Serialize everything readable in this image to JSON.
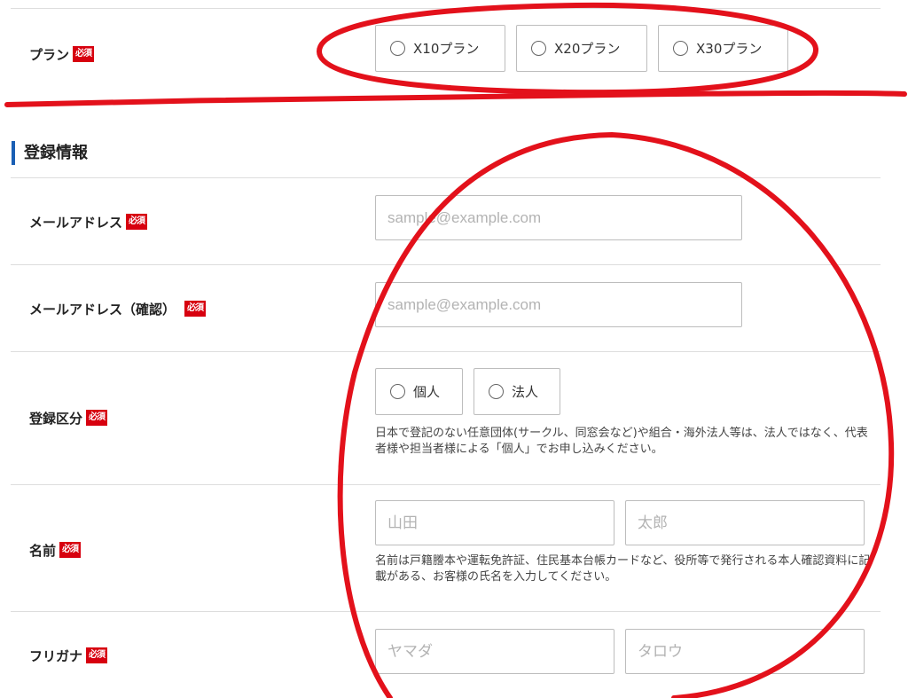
{
  "required_badge": "必須",
  "plan": {
    "label": "プラン",
    "options": [
      "X10プラン",
      "X20プラン",
      "X30プラン"
    ]
  },
  "section": {
    "title": "登録情報"
  },
  "email": {
    "label": "メールアドレス",
    "placeholder": "sample@example.com"
  },
  "email_confirm": {
    "label": "メールアドレス（確認）",
    "placeholder": "sample@example.com"
  },
  "registration_type": {
    "label": "登録区分",
    "options": [
      "個人",
      "法人"
    ],
    "note": "日本で登記のない任意団体(サークル、同窓会など)や組合・海外法人等は、法人ではなく、代表者様や担当者様による「個人」でお申し込みください。"
  },
  "name": {
    "label": "名前",
    "last_placeholder": "山田",
    "first_placeholder": "太郎",
    "note": "名前は戸籍謄本や運転免許証、住民基本台帳カードなど、役所等で発行される本人確認資料に記載がある、お客様の氏名を入力してください。"
  },
  "furigana": {
    "label": "フリガナ",
    "last_placeholder": "ヤマダ",
    "first_placeholder": "タロウ"
  },
  "colors": {
    "required_badge": "#d7000f",
    "section_accent": "#1a5fb4",
    "annotation": "#e3111b"
  }
}
